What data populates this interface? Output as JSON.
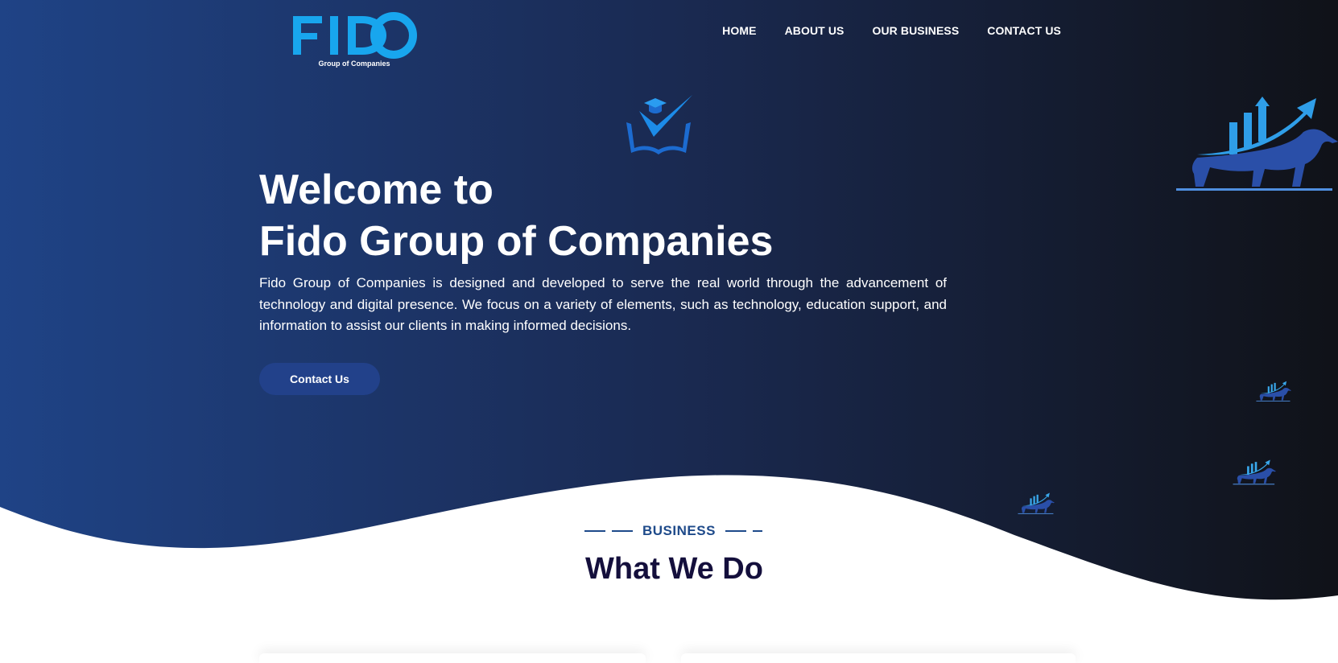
{
  "logo": {
    "wordmark": "FIDO",
    "tagline": "Group of Companies"
  },
  "nav": {
    "home": "HOME",
    "about": "ABOUT US",
    "business": "OUR BUSINESS",
    "contact": "CONTACT US"
  },
  "hero": {
    "title_line1": "Welcome to",
    "title_line2": "Fido Group of Companies",
    "description": "Fido Group of Companies is designed and developed to serve the real world through the advancement of technology and digital presence. We focus on a variety of elements, such as technology, education support, and information to assist our clients in making informed decisions.",
    "cta_label": "Contact Us"
  },
  "section": {
    "tag": "BUSINESS",
    "title": "What We Do"
  },
  "icons": [
    "education-check-icon",
    "bull-growth-icon"
  ],
  "colors": {
    "hero_start": "#1f4386",
    "hero_end": "#101218",
    "accent": "#18a6ee",
    "button": "#22418a",
    "section_tag": "#1e4a8a",
    "section_title": "#140f3c"
  }
}
